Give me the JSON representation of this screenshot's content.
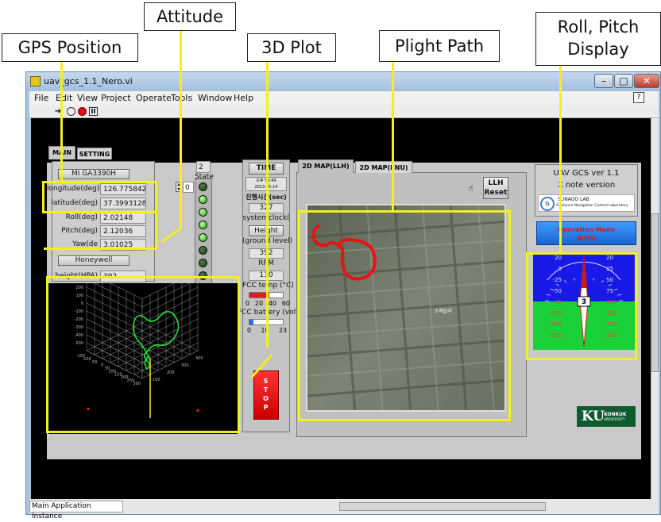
{
  "callouts": {
    "gps": "GPS Position",
    "attitude": "Attitude",
    "plot3d": "3D Plot",
    "flight_path": "Plight Path",
    "roll_pitch_line1": "Roll, Pitch",
    "roll_pitch_line2": "Display"
  },
  "window": {
    "title": "uav_gcs_1.1_Nero.vi",
    "btn_min": "–",
    "btn_max": "□",
    "btn_close": "✕"
  },
  "menu": [
    "File",
    "Edit",
    "View",
    "Project",
    "Operate",
    "Tools",
    "Window",
    "Help"
  ],
  "statusbar": {
    "text": "Main Application Instance"
  },
  "tabs": {
    "main": "MAIN",
    "setting": "SETTING"
  },
  "gps": {
    "device": "MI GA3390H",
    "longitude_label": "longitude(deg)",
    "longitude_value": "126.7758423",
    "latitude_label": "latitude(deg)",
    "latitude_value": "37.39931284"
  },
  "attitude": {
    "roll_label": "Roll(deg)",
    "roll_value": "2.02148",
    "pitch_label": "Pitch(deg)",
    "pitch_value": "2.12036",
    "yaw_label": "Yaw(de",
    "yaw_value": "3.01025",
    "device": "Honeywell",
    "height_label": "height(HPA)",
    "height_value": "392"
  },
  "state": {
    "count": "2",
    "label": "State",
    "index": "0",
    "leds_on": [
      false,
      true,
      true,
      true,
      true,
      false,
      false,
      false
    ]
  },
  "time_panel": {
    "button": "TIME",
    "clock_time": "오후 59:49",
    "clock_date": "2013-05-14",
    "elapsed_label": "진행시간(sec)",
    "elapsed_value": "327",
    "systemclock_label": "systemclock(",
    "height_button": "Height",
    "height_label": "(ground level)",
    "rpm_value": "392",
    "rpm_label": "RPM",
    "fcc_temp_value": "130",
    "fcc_temp_label": "FCC temp (°C)",
    "fcc_temp_fill": 0.6,
    "temp_ticks": [
      "0",
      "20",
      "40",
      "60"
    ],
    "fcc_batt_label": "FCC battery (volt)",
    "fcc_batt_fill": 0.12,
    "batt_ticks": [
      "0",
      "10",
      "23"
    ],
    "stop_label": "STOP"
  },
  "map": {
    "tab_llh": "2D MAP(LLH)",
    "tab_enu": "2D MAP(ENU)",
    "reset_line1": "LLH",
    "reset_line2": "Reset",
    "map_text": "소래습지"
  },
  "plot3d": {
    "axis_values": [
      "400",
      "300",
      "200",
      "100",
      "0",
      "-100",
      "-200",
      "-300",
      "-400",
      "-500",
      "-150",
      "-100",
      "-50",
      "0",
      "50",
      "100",
      "150",
      "200",
      "250",
      "300",
      "100",
      "200",
      "300",
      "400"
    ]
  },
  "right": {
    "gcs_title": "UAV GCS ver 1.1",
    "gcs_version": "X note version",
    "lab_line1": "SUNAOO LAB",
    "lab_line2": "Guidance Navigation Control Laboratory",
    "mode_label": "Operation Mode",
    "mode_value": "AUTO",
    "ku_mark": "KU",
    "ku_line1": "KONKUK",
    "ku_line2": "UNIVERSITY"
  },
  "horizon": {
    "readout": "3",
    "left_ticks": [
      "20",
      "0",
      "-25",
      "-50",
      "-75",
      "-100",
      "-150",
      "-200"
    ],
    "right_ticks": [
      "20",
      "25",
      "50",
      "75",
      "100",
      "125",
      "150",
      "200"
    ],
    "colors": {
      "sky": "#1a1ae8",
      "ground": "#1bd13a"
    }
  }
}
